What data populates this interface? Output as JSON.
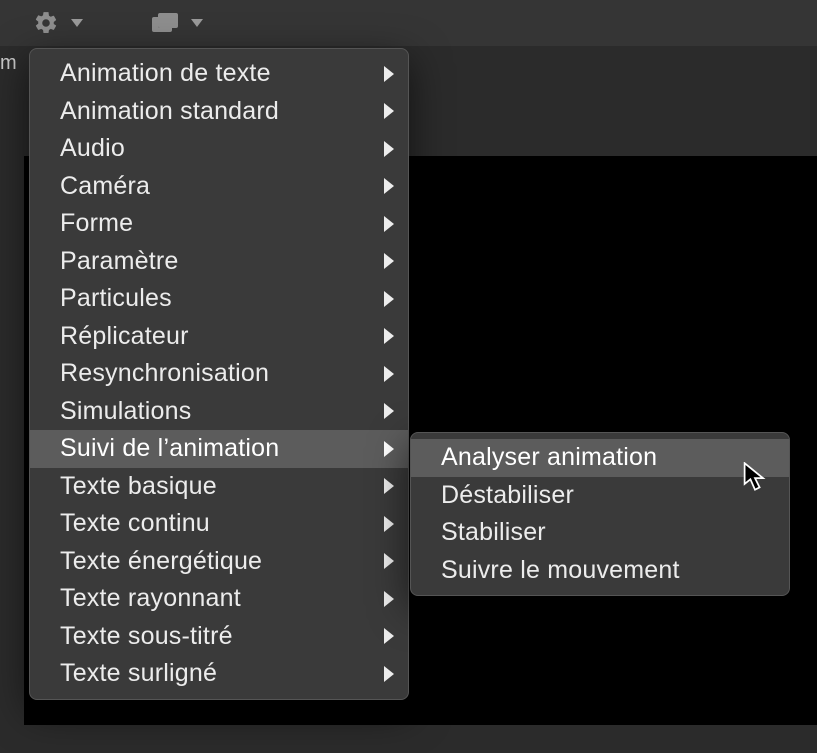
{
  "left_gutter_text": "m",
  "toolbar": {
    "gear": "settings",
    "windows": "windows"
  },
  "menu": {
    "items": [
      {
        "label": "Animation de texte"
      },
      {
        "label": "Animation standard"
      },
      {
        "label": "Audio"
      },
      {
        "label": "Caméra"
      },
      {
        "label": "Forme"
      },
      {
        "label": "Paramètre"
      },
      {
        "label": "Particules"
      },
      {
        "label": "Réplicateur"
      },
      {
        "label": "Resynchronisation"
      },
      {
        "label": "Simulations"
      },
      {
        "label": "Suivi de l’animation",
        "highlighted": true
      },
      {
        "label": "Texte basique"
      },
      {
        "label": "Texte continu"
      },
      {
        "label": "Texte énergétique"
      },
      {
        "label": "Texte rayonnant"
      },
      {
        "label": "Texte sous-titré"
      },
      {
        "label": "Texte surligné"
      }
    ]
  },
  "submenu": {
    "parent": "Suivi de l’animation",
    "items": [
      {
        "label": "Analyser animation",
        "highlighted": true
      },
      {
        "label": "Déstabiliser"
      },
      {
        "label": "Stabiliser"
      },
      {
        "label": "Suivre le mouvement"
      }
    ]
  }
}
